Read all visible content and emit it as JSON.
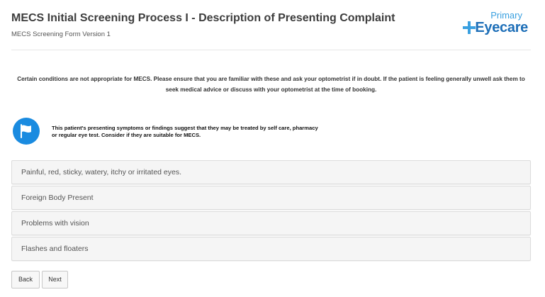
{
  "header": {
    "title": "MECS Initial Screening Process I - Description of Presenting Complaint",
    "subtitle": "MECS Screening Form Version 1"
  },
  "logo": {
    "primary": "Primary",
    "eyecare": "Eyecare",
    "accent_color": "#1e6fb8",
    "icon": "plus-cross-icon"
  },
  "notice": {
    "text": "Certain conditions are not appropriate for MECS. Please ensure that you are familiar with these and ask your optometrist if in doubt. If the patient is feeling generally unwell ask them to seek medical advice or discuss with your optometrist at the time of booking."
  },
  "info": {
    "icon": "flag-icon",
    "icon_color": "#1a8be0",
    "text": "This patient's presenting symptoms or findings suggest that they may be treated by self care, pharmacy or regular eye test.  Consider if they are suitable for MECS."
  },
  "options": [
    {
      "label": "Painful, red, sticky, watery, itchy or irritated eyes."
    },
    {
      "label": "Foreign Body Present"
    },
    {
      "label": "Problems with vision"
    },
    {
      "label": "Flashes and floaters"
    }
  ],
  "buttons": {
    "back": "Back",
    "next": "Next"
  }
}
